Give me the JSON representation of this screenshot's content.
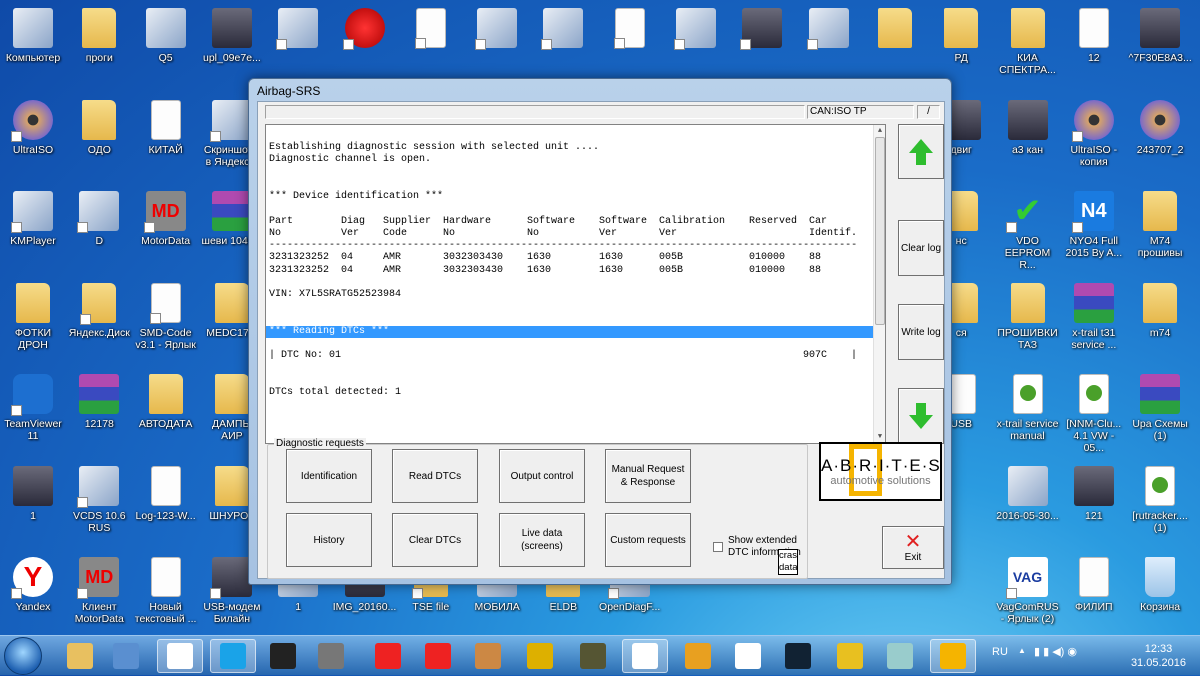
{
  "desktop": {
    "rows": [
      [
        {
          "l": "Компьютер",
          "i": "app"
        },
        {
          "l": "проги",
          "i": "folder"
        },
        {
          "l": "Q5",
          "i": "app"
        },
        {
          "l": "upl_09e7e...",
          "i": "img"
        },
        {
          "l": "",
          "i": "app",
          "s": 1
        },
        {
          "l": "",
          "i": "red",
          "s": 1
        },
        {
          "l": "",
          "i": "doc",
          "s": 1
        },
        {
          "l": "",
          "i": "app",
          "s": 1
        },
        {
          "l": "",
          "i": "app",
          "s": 1
        },
        {
          "l": "",
          "i": "doc",
          "s": 1
        },
        {
          "l": "",
          "i": "app",
          "s": 1
        },
        {
          "l": "",
          "i": "img",
          "s": 1
        },
        {
          "l": "",
          "i": "app",
          "s": 1
        },
        {
          "l": "",
          "i": "folder"
        },
        {
          "l": "РД",
          "i": "folder"
        },
        {
          "l": "КИА СПЕКТРА...",
          "i": "folder"
        },
        {
          "l": "12",
          "i": "doc"
        },
        {
          "l": "^7F30E8A3...",
          "i": "img"
        }
      ],
      [
        {
          "l": "UltraISO",
          "i": "disc",
          "s": 1
        },
        {
          "l": "ОДО",
          "i": "folder"
        },
        {
          "l": "КИТАЙ",
          "i": "doc"
        },
        {
          "l": "Скриншоты в Яндекс...",
          "i": "app",
          "s": 1
        },
        null,
        null,
        null,
        null,
        null,
        null,
        null,
        null,
        null,
        null,
        {
          "l": "двиг",
          "i": "img"
        },
        {
          "l": "a3 кан",
          "i": "img"
        },
        {
          "l": "UltraISO - копия",
          "i": "disc",
          "s": 1
        },
        {
          "l": "243707_2",
          "i": "disc"
        }
      ],
      [
        {
          "l": "KMPlayer",
          "i": "app",
          "s": 1
        },
        {
          "l": "D",
          "i": "app",
          "s": 1
        },
        {
          "l": "MotorData",
          "i": "md",
          "s": 1
        },
        {
          "l": "шеви 1046...",
          "i": "rar"
        },
        null,
        null,
        null,
        null,
        null,
        null,
        null,
        null,
        null,
        null,
        {
          "l": "нс",
          "i": "folder"
        },
        {
          "l": "VDO EEPROM R...",
          "i": "check",
          "s": 1
        },
        {
          "l": "NYO4 Full 2015 By A...",
          "i": "n4",
          "s": 1
        },
        {
          "l": "M74 прошивы",
          "i": "folder"
        }
      ],
      [
        {
          "l": "ФОТКИ ДРОН",
          "i": "folder"
        },
        {
          "l": "Яндекс.Диск",
          "i": "folder",
          "s": 1
        },
        {
          "l": "SMD-Code v3.1 - Ярлык",
          "i": "doc",
          "s": 1
        },
        {
          "l": "MEDC17...",
          "i": "folder"
        },
        null,
        null,
        null,
        null,
        null,
        null,
        null,
        null,
        null,
        null,
        {
          "l": "ся",
          "i": "folder"
        },
        {
          "l": "ПРОШИВКИ ТАЗ",
          "i": "folder"
        },
        {
          "l": "x-trail t31 service ...",
          "i": "rar"
        },
        {
          "l": "m74",
          "i": "folder"
        }
      ],
      [
        {
          "l": "TeamViewer 11",
          "i": "team",
          "s": 1
        },
        {
          "l": "12178",
          "i": "rar"
        },
        {
          "l": "АВТОДАТА",
          "i": "folder"
        },
        {
          "l": "ДАМПЫ АИР",
          "i": "folder"
        },
        null,
        null,
        null,
        null,
        null,
        null,
        null,
        null,
        null,
        null,
        {
          "l": "USB",
          "i": "doc"
        },
        {
          "l": "x-trail service manual",
          "i": "torrent"
        },
        {
          "l": "[NNM-Clu... 4.1 VW - 05...",
          "i": "torrent"
        },
        {
          "l": "Upa Схемы (1)",
          "i": "rar"
        }
      ],
      [
        {
          "l": "1",
          "i": "img"
        },
        {
          "l": "VCDS 10.6 RUS",
          "i": "app",
          "s": 1
        },
        {
          "l": "Log-123-W...",
          "i": "doc"
        },
        {
          "l": "ШНУРОК",
          "i": "folder"
        },
        null,
        null,
        null,
        null,
        null,
        null,
        null,
        null,
        null,
        null,
        null,
        {
          "l": "2016-05-30...",
          "i": "app"
        },
        {
          "l": "121",
          "i": "img"
        },
        {
          "l": "[rutracker.... (1)",
          "i": "torrent"
        }
      ],
      [
        {
          "l": "Yandex",
          "i": "yandex",
          "s": 1
        },
        {
          "l": "Клиент MotorData",
          "i": "md",
          "s": 1
        },
        {
          "l": "Новый текстовый ...",
          "i": "doc"
        },
        {
          "l": "USB-модем Билайн",
          "i": "img",
          "s": 1
        },
        {
          "l": "1",
          "i": "app"
        },
        {
          "l": "IMG_20160...",
          "i": "img"
        },
        {
          "l": "TSE file",
          "i": "folder",
          "s": 1
        },
        {
          "l": "МОБИЛА",
          "i": "app"
        },
        {
          "l": "ELDB",
          "i": "folder"
        },
        {
          "l": "OpenDiagF...",
          "i": "app",
          "s": 1
        },
        null,
        null,
        null,
        null,
        null,
        {
          "l": "VagComRUS - Ярлык (2)",
          "i": "vag",
          "s": 1
        },
        {
          "l": "ФИЛИП",
          "i": "doc"
        },
        {
          "l": "Корзина",
          "i": "bin"
        }
      ]
    ]
  },
  "window": {
    "title": "Airbag-SRS",
    "status_field": "",
    "protocol": "CAN:ISO TP",
    "status_slash": "/",
    "log": {
      "lines": [
        {
          "t": "Establishing diagnostic session with selected unit ...."
        },
        {
          "t": "Diagnostic channel is open."
        },
        {
          "t": ""
        },
        {
          "t": ""
        },
        {
          "t": "*** Device identification ***"
        },
        {
          "t": ""
        },
        {
          "table": "header1"
        },
        {
          "table": "header2"
        },
        {
          "t": "--------------------------------------------------------------------------------------------------"
        },
        {
          "table": "row0"
        },
        {
          "table": "row1"
        },
        {
          "t": ""
        },
        {
          "t": "VIN: X7L5SRATG52523984"
        },
        {
          "t": ""
        },
        {
          "t": ""
        },
        {
          "t": "*** Reading DTCs ***",
          "selected": true
        },
        {
          "t": ""
        },
        {
          "dtc": true
        },
        {
          "t": ""
        },
        {
          "t": ""
        },
        {
          "t": "DTCs total detected: 1"
        }
      ],
      "table": {
        "header1": [
          "Part",
          "Diag",
          "Supplier",
          "Hardware",
          "Software",
          "Software",
          "Calibration",
          "Reserved",
          "Car"
        ],
        "header2": [
          "No",
          "Ver",
          "Code",
          "No",
          "No",
          "Ver",
          "Ver",
          "",
          "Identif."
        ],
        "row0": [
          "3231323252",
          "04",
          "AMR",
          "3032303430",
          "1630",
          "1630",
          "005B",
          "010000",
          "88"
        ],
        "row1": [
          "3231323252",
          "04",
          "AMR",
          "3032303430",
          "1630",
          "1630",
          "005B",
          "010000",
          "88"
        ]
      },
      "dtc": {
        "prefix": "|",
        "label": "DTC No: 01",
        "code": "907C",
        "suffix": "|"
      }
    },
    "side_buttons": {
      "scroll_up": "scroll-up",
      "clear_log": "Clear log",
      "write_log": "Write log",
      "scroll_down": "scroll-down"
    },
    "group_label": "Diagnostic requests",
    "requests": [
      "Identification",
      "Read DTCs",
      "Output control",
      "Manual Request & Response",
      "History",
      "Clear DTCs",
      "Live data (screens)",
      "Custom requests"
    ],
    "show_extended": {
      "label": "Show extended DTC information",
      "checked": false
    },
    "crash_data": "crash data",
    "logo": {
      "line1": "A·B·R·I·T·E·S",
      "line2": "automotive solutions"
    },
    "exit": "Exit"
  },
  "taskbar": {
    "items": [
      {
        "name": "explorer",
        "c": "#e8c060"
      },
      {
        "name": "snipping",
        "c": "#5a8fd0"
      },
      {
        "name": "yandex-browser",
        "c": "#fff",
        "active": true
      },
      {
        "name": "skype",
        "c": "#1aa3e8",
        "active": true
      },
      {
        "name": "barcode",
        "c": "#222"
      },
      {
        "name": "chip",
        "c": "#777"
      },
      {
        "name": "target-1",
        "c": "#e22"
      },
      {
        "name": "target-2",
        "c": "#e22"
      },
      {
        "name": "blocked",
        "c": "#c84"
      },
      {
        "name": "tool",
        "c": "#ddb000"
      },
      {
        "name": "ecu",
        "c": "#553"
      },
      {
        "name": "abrites",
        "c": "#fff",
        "active": true
      },
      {
        "name": "pen",
        "c": "#e8a020"
      },
      {
        "name": "hxd",
        "c": "#fff"
      },
      {
        "name": "bracket",
        "c": "#123"
      },
      {
        "name": "bispa",
        "c": "#e8c020"
      },
      {
        "name": "calculator",
        "c": "#9cc"
      },
      {
        "name": "a-app",
        "c": "#f5b400",
        "active": true
      }
    ],
    "tray": {
      "lang": "RU",
      "time": "12:33",
      "date": "31.05.2016"
    }
  }
}
